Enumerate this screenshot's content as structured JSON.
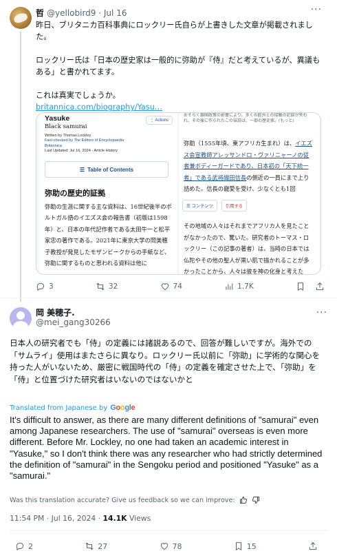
{
  "tweet1": {
    "author_name": "哲",
    "handle": "@yellobird9",
    "date": "· Jul 16",
    "body_lines": [
      "昨日、ブリタニカ百科事典にロックリー氏自らが上書きした文章が掲載されました。",
      "ロックリー氏は「日本の歴史家は一般的に弥助が『侍』だと考えているが、異議もある」と書かれてます。",
      "これは真実でしょうか。"
    ],
    "link": "britannica.com/biography/Yasu…",
    "card_left": {
      "title": "Yasuke",
      "subtitle": "Black samurai",
      "meta_written": "Written by Thomas Lockley",
      "meta_fact": "Fact-checked by The Editors of Encyclopaedia Britannica",
      "meta_updated": "Last Updated: Jul 16, 2024 · Article History",
      "actions": "⋮ Actions",
      "toc": "Table of Contents",
      "heading": "弥助の歴史的証拠",
      "body": "弥助の生涯に関する主な資料は、16世紀後半のポルトガル語のイエズス会の報告書（初版は1598年）と、日本の年代記作者である太田牛一と松平家忠の著作である。2021年に東京大学の岡美穂子教授が発見したモザンビークからの手紙など、弥助に関するものと思われる資料は他に"
    },
    "card_right": {
      "top": "おそらく鎖国政策の影響により、多くの欧州との接触の記録が失われ、その後に作られたこの伝説は、一部の歴史家。(もっと)",
      "p1_pre": "弥助（1555年頃、東アフリカ生まれ）は、",
      "p1_link1": "イエズス会宣教師アレッサンドロ・ヴァリニャーノの従者兼ボディーガードであり、日本初の「天下統一者」である武将織田信長",
      "p1_post": "の側近の一員にまで上り詰めた。信長の寵愛を受け、少なくとも1回",
      "btn_contents": "☰ コンテンツ",
      "btn_cite": "引用する",
      "p2": "その地域の人々はそれまでアフリカ人を見たことがなかったので、驚いた。研究者のトーマス・ロックリー（この記事の著者）は、当時の日本では仏陀やその他の聖人が黒い肌で描かれることが多かったことから、人々は彼を神の化身と考えた"
    },
    "stats": {
      "replies": "3",
      "reposts": "32",
      "likes": "74",
      "views": "1.7K"
    }
  },
  "tweet2": {
    "author_name": "岡 美穂子.",
    "handle": "@mei_gang30266",
    "body_jp": "日本人の研究者でも「侍」の定義には諸説あるので、回答が難しいですが。海外での「サムライ」使用はまたさらに異なり。ロックリー氏以前に「弥助」に学術的な関心を持った人がいないため、厳密に戦国時代の「侍」の定義を確定させた上で、「弥助」を「侍」と位置づけた研究者はいないのではないかと",
    "translated_from": "Translated from Japanese by",
    "google": "Google",
    "body_en": "It's difficult to answer, as there are many different definitions of \"samurai\" even among Japanese researchers. The use of \"samurai\" overseas is even more different. Before Mr. Lockley, no one had taken an academic interest in \"Yasuke,\" so I don't think there was any researcher who had strictly determined the definition of \"samurai\" in the Sengoku period and positioned \"Yasuke\" as a \"samurai.\"",
    "feedback": "Was this translation accurate? Give us feedback so we can improve:",
    "timestamp": "11:54 PM · Jul 16, 2024 · ",
    "views_count": "14.1K",
    "views_label": " Views",
    "stats": {
      "replies": "2",
      "reposts": "27",
      "likes": "78",
      "bookmarks": "15"
    }
  },
  "colors": {
    "link": "#1d9bf0",
    "secondary": "#536471",
    "text": "#0f1419"
  },
  "icons": [
    "reply-icon",
    "repost-icon",
    "like-icon",
    "views-icon",
    "bookmark-icon",
    "share-icon",
    "more-icon",
    "thumbs-up-icon",
    "thumbs-down-icon"
  ]
}
